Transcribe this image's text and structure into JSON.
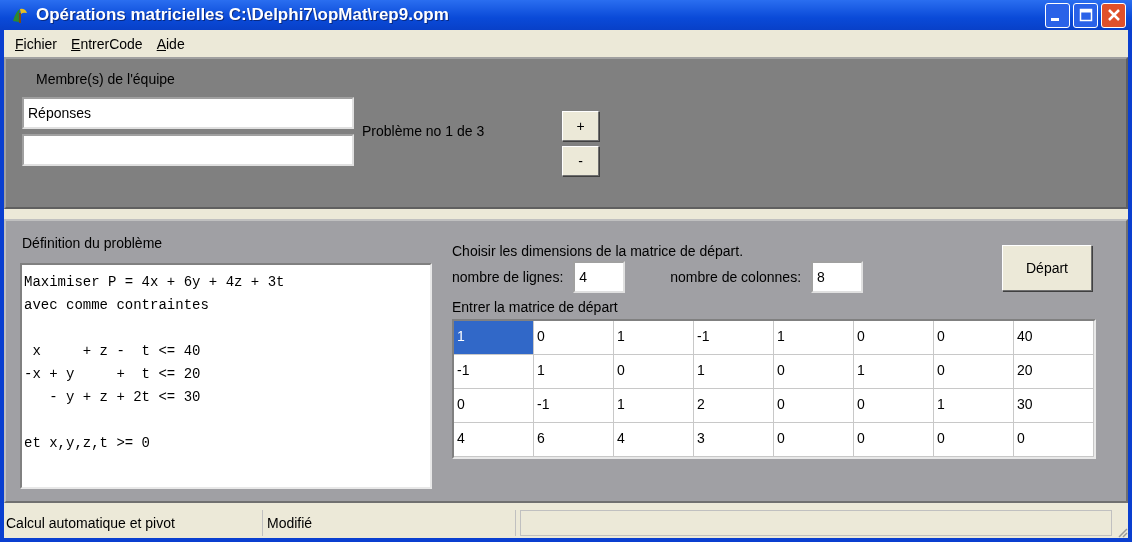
{
  "window": {
    "title": "Opérations matricielles C:\\Delphi7\\opMat\\rep9.opm"
  },
  "menu": [
    "Fichier",
    "EntrerCode",
    "Aide"
  ],
  "team": {
    "label": "Membre(s) de l'équipe",
    "members": [
      {
        "kind": "field",
        "value": "Réponses"
      },
      {
        "kind": "field"
      }
    ],
    "problem_counter": "Problème no 1 de 3",
    "buttons": [
      "+",
      "-"
    ]
  },
  "definition": {
    "label": "Définition du problème",
    "text": "Maximiser P = 4x + 6y + 4z + 3t\navec comme contraintes\n\n x     + z -  t <= 40\n-x + y     +  t <= 20\n   - y + z + 2t <= 30\n\net x,y,z,t >= 0"
  },
  "dimensions": {
    "label": "Choisir les dimensions de la matrice de départ.",
    "rows_label": "nombre de lignes:",
    "rows_value": "4",
    "columns_label": "nombre de colonnes:",
    "columns_value": "8",
    "start_button": "Départ"
  },
  "matrix": {
    "label": "Entrer la matrice de départ",
    "rows": [
      [
        {
          "text": "1",
          "selected": true
        },
        {
          "text": "0",
          "selected": false
        },
        {
          "text": "1",
          "selected": false
        },
        {
          "text": "-1",
          "selected": false
        },
        {
          "text": "1",
          "selected": false
        },
        {
          "text": "0",
          "selected": false
        },
        {
          "text": "0",
          "selected": false
        },
        {
          "text": "40",
          "selected": false
        }
      ],
      [
        {
          "text": "-1",
          "selected": false
        },
        {
          "text": "1",
          "selected": false
        },
        {
          "text": "0",
          "selected": false
        },
        {
          "text": "1",
          "selected": false
        },
        {
          "text": "0",
          "selected": false
        },
        {
          "text": "1",
          "selected": false
        },
        {
          "text": "0",
          "selected": false
        },
        {
          "text": "20",
          "selected": false
        }
      ],
      [
        {
          "text": "0",
          "selected": false
        },
        {
          "text": "-1",
          "selected": false
        },
        {
          "text": "1",
          "selected": false
        },
        {
          "text": "2",
          "selected": false
        },
        {
          "text": "0",
          "selected": false
        },
        {
          "text": "0",
          "selected": false
        },
        {
          "text": "1",
          "selected": false
        },
        {
          "text": "30",
          "selected": false
        }
      ],
      [
        {
          "text": "4",
          "selected": false
        },
        {
          "text": "6",
          "selected": false
        },
        {
          "text": "4",
          "selected": false
        },
        {
          "text": "3",
          "selected": false
        },
        {
          "text": "0",
          "selected": false
        },
        {
          "text": "0",
          "selected": false
        },
        {
          "text": "0",
          "selected": false
        },
        {
          "text": "0",
          "selected": false
        }
      ]
    ]
  },
  "status_bar": [
    "Calcul automatique et pivot",
    "Modifié"
  ]
}
